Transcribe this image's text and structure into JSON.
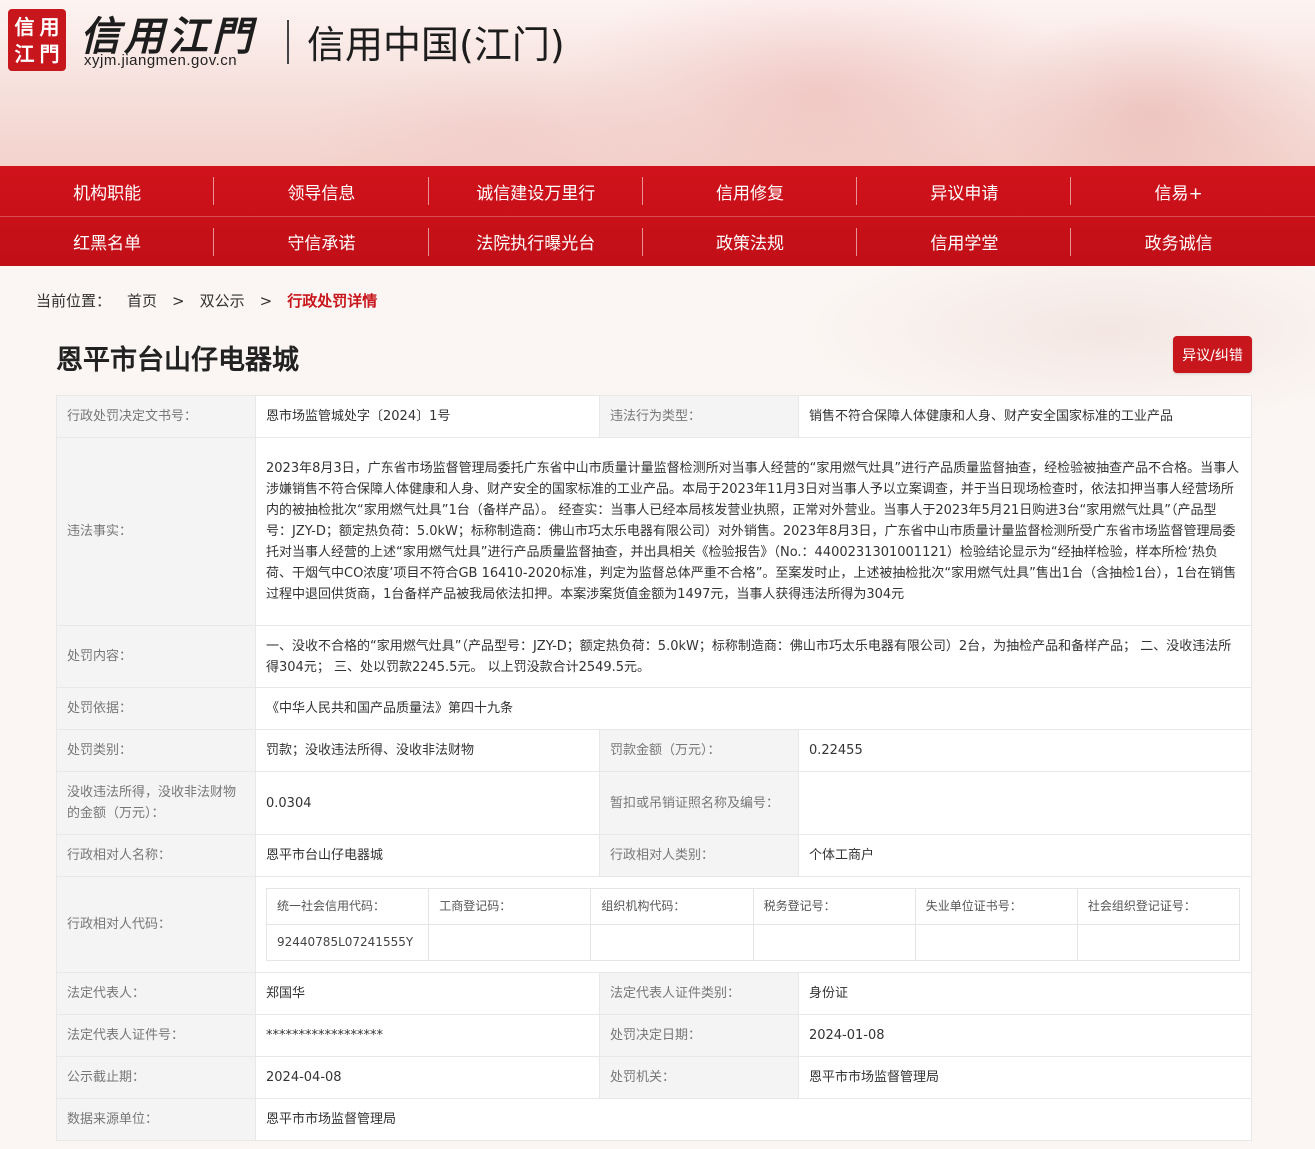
{
  "header": {
    "seal_chars": [
      "信",
      "用",
      "江",
      "門"
    ],
    "logo_script": "信用江門",
    "domain": "xyjm.jiangmen.gov.cn",
    "site_name": "信用中国(江门)"
  },
  "nav": {
    "row1": [
      "机构职能",
      "领导信息",
      "诚信建设万里行",
      "信用修复",
      "异议申请",
      "信易+"
    ],
    "row2": [
      "红黑名单",
      "守信承诺",
      "法院执行曝光台",
      "政策法规",
      "信用学堂",
      "政务诚信"
    ]
  },
  "breadcrumb": {
    "label": "当前位置：",
    "items": [
      "首页",
      "双公示"
    ],
    "separator": ">",
    "current": "行政处罚详情"
  },
  "page": {
    "title": "恩平市台山仔电器城",
    "objection_button": "异议/纠错"
  },
  "detail": {
    "decision_no_label": "行政处罚决定文书号：",
    "decision_no": "恩市场监管城处字〔2024〕1号",
    "violation_type_label": "违法行为类型：",
    "violation_type": "销售不符合保障人体健康和人身、财产安全国家标准的工业产品",
    "facts_label": "违法事实：",
    "facts": "2023年8月3日，广东省市场监督管理局委托广东省中山市质量计量监督检测所对当事人经营的“家用燃气灶具”进行产品质量监督抽查，经检验被抽查产品不合格。当事人涉嫌销售不符合保障人体健康和人身、财产安全的国家标准的工业产品。本局于2023年11月3日对当事人予以立案调查，并于当日现场检查时，依法扣押当事人经营场所内的被抽检批次“家用燃气灶具”1台（备样产品）。 经查实：当事人已经本局核发营业执照，正常对外营业。当事人于2023年5月21日购进3台“家用燃气灶具”（产品型号：JZY-D；额定热负荷：5.0kW；标称制造商：佛山市巧太乐电器有限公司）对外销售。2023年8月3日，广东省中山市质量计量监督检测所受广东省市场监督管理局委托对当事人经营的上述“家用燃气灶具”进行产品质量监督抽查，并出具相关《检验报告》（No.：4400231301001121）检验结论显示为“经抽样检验，样本所检‘热负荷、干烟气中CO浓度’项目不符合GB 16410-2020标准，判定为监督总体严重不合格”。至案发时止，上述被抽检批次“家用燃气灶具”售出1台（含抽检1台），1台在销售过程中退回供货商，1台备样产品被我局依法扣押。本案涉案货值金额为1497元，当事人获得违法所得为304元",
    "content_label": "处罚内容：",
    "content": "一、没收不合格的“家用燃气灶具”（产品型号：JZY-D；额定热负荷：5.0kW；标称制造商：佛山市巧太乐电器有限公司）2台，为抽检产品和备样产品； 二、没收违法所得304元； 三、处以罚款2245.5元。 以上罚没款合计2549.5元。",
    "basis_label": "处罚依据：",
    "basis": "《中华人民共和国产品质量法》第四十九条",
    "category_label": "处罚类别：",
    "category": "罚款；没收违法所得、没收非法财物",
    "fine_label": "罚款金额（万元）：",
    "fine": "0.22455",
    "confiscation_label": "没收违法所得，没收非法财物的金额（万元）：",
    "confiscation": "0.0304",
    "license_label": "暂扣或吊销证照名称及编号：",
    "license": "",
    "party_name_label": "行政相对人名称：",
    "party_name": "恩平市台山仔电器城",
    "party_type_label": "行政相对人类别：",
    "party_type": "个体工商户",
    "party_code_label": "行政相对人代码：",
    "code_headers": [
      "统一社会信用代码：",
      "工商登记码：",
      "组织机构代码：",
      "税务登记号：",
      "失业单位证书号：",
      "社会组织登记证号："
    ],
    "code_values": [
      "92440785L07241555Y",
      "",
      "",
      "",
      "",
      ""
    ],
    "legal_rep_label": "法定代表人：",
    "legal_rep": "郑国华",
    "id_type_label": "法定代表人证件类别：",
    "id_type": "身份证",
    "id_no_label": "法定代表人证件号：",
    "id_no": "******************",
    "decision_date_label": "处罚决定日期：",
    "decision_date": "2024-01-08",
    "publicity_end_label": "公示截止期：",
    "publicity_end": "2024-04-08",
    "authority_label": "处罚机关：",
    "authority": "恩平市市场监督管理局",
    "source_label": "数据来源单位：",
    "source": "恩平市市场监督管理局"
  },
  "colors": {
    "brand_red": "#c8161d",
    "label_bg": "#f4f4f4"
  }
}
